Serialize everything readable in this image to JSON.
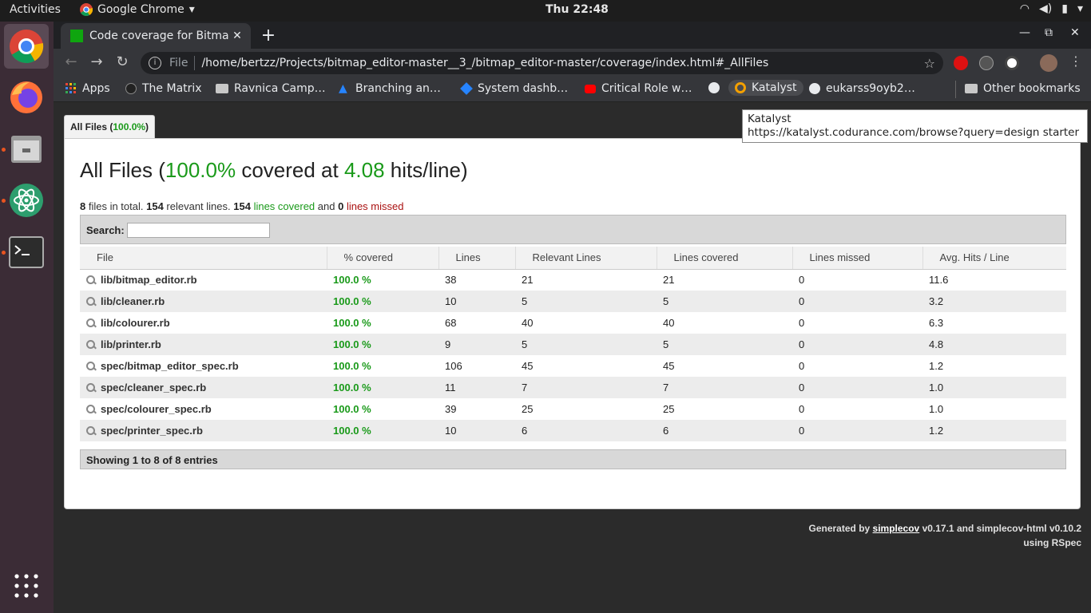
{
  "topbar": {
    "activities": "Activities",
    "app_name": "Google Chrome",
    "clock": "Thu 22:48"
  },
  "browser": {
    "tab_title": "Code coverage for Bitmap",
    "url_scheme": "File",
    "url": "/home/bertzz/Projects/bitmap_editor-master__3_/bitmap_editor-master/coverage/index.html#_AllFiles",
    "bookmarks": [
      "Apps",
      "The Matrix",
      "Ravnica Camp…",
      "Branching an…",
      "System dashb…",
      "Critical Role w…",
      "Katalyst",
      "eukarss9oyb2…"
    ],
    "other_bookmarks": "Other bookmarks",
    "tooltip_title": "Katalyst",
    "tooltip_url": "https://katalyst.codurance.com/browse?query=design starter"
  },
  "page": {
    "tab_label": "All Files (",
    "tab_percent": "100.0%",
    "tab_close": ")",
    "heading_prefix": "All Files (",
    "heading_percent": "100.0%",
    "heading_mid": " covered at ",
    "heading_hits": "4.08",
    "heading_suffix": " hits/line)",
    "summary": {
      "files": "8",
      "files_text": " files in total. ",
      "relevant": "154",
      "relevant_text": " relevant lines. ",
      "covered": "154",
      "covered_text": " lines covered",
      "and_text": " and ",
      "missed": "0",
      "missed_text": " lines missed"
    },
    "search_label": "Search:",
    "columns": [
      "File",
      "% covered",
      "Lines",
      "Relevant Lines",
      "Lines covered",
      "Lines missed",
      "Avg. Hits / Line"
    ],
    "rows": [
      {
        "file": "lib/bitmap_editor.rb",
        "covered": "100.0 %",
        "lines": "38",
        "relevant": "21",
        "lines_covered": "21",
        "missed": "0",
        "avg": "11.6"
      },
      {
        "file": "lib/cleaner.rb",
        "covered": "100.0 %",
        "lines": "10",
        "relevant": "5",
        "lines_covered": "5",
        "missed": "0",
        "avg": "3.2"
      },
      {
        "file": "lib/colourer.rb",
        "covered": "100.0 %",
        "lines": "68",
        "relevant": "40",
        "lines_covered": "40",
        "missed": "0",
        "avg": "6.3"
      },
      {
        "file": "lib/printer.rb",
        "covered": "100.0 %",
        "lines": "9",
        "relevant": "5",
        "lines_covered": "5",
        "missed": "0",
        "avg": "4.8"
      },
      {
        "file": "spec/bitmap_editor_spec.rb",
        "covered": "100.0 %",
        "lines": "106",
        "relevant": "45",
        "lines_covered": "45",
        "missed": "0",
        "avg": "1.2"
      },
      {
        "file": "spec/cleaner_spec.rb",
        "covered": "100.0 %",
        "lines": "11",
        "relevant": "7",
        "lines_covered": "7",
        "missed": "0",
        "avg": "1.0"
      },
      {
        "file": "spec/colourer_spec.rb",
        "covered": "100.0 %",
        "lines": "39",
        "relevant": "25",
        "lines_covered": "25",
        "missed": "0",
        "avg": "1.0"
      },
      {
        "file": "spec/printer_spec.rb",
        "covered": "100.0 %",
        "lines": "10",
        "relevant": "6",
        "lines_covered": "6",
        "missed": "0",
        "avg": "1.2"
      }
    ],
    "showing": "Showing 1 to 8 of 8 entries",
    "generated_by": "Generated by ",
    "simplecov": "simplecov",
    "generated_rest": " v0.17.1 and simplecov-html v0.10.2",
    "using": "using RSpec"
  },
  "colors": {
    "covered_green": "#1a9a1a",
    "missed_red": "#aa1111",
    "dock_bg": "#3b2c36"
  },
  "icons": {
    "tab_favicon": "green-square-icon",
    "dock": [
      "chrome-icon",
      "firefox-icon",
      "files-icon",
      "atom-icon",
      "terminal-icon",
      "app-grid-icon"
    ]
  }
}
